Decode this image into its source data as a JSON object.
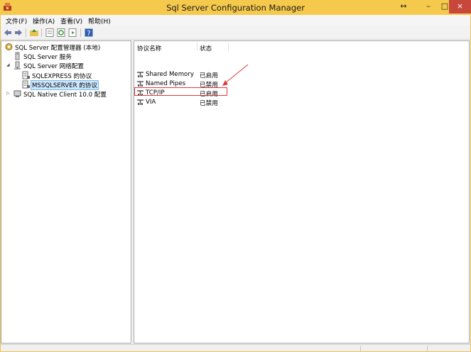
{
  "window": {
    "title": "Sql Server Configuration Manager",
    "restore_symbol": "↔",
    "minimize_symbol": "–",
    "maximize_symbol": "□",
    "close_symbol": "×"
  },
  "menu": {
    "items": [
      "文件(F)",
      "操作(A)",
      "查看(V)",
      "帮助(H)"
    ]
  },
  "toolbar": {
    "icons": [
      "back-icon",
      "forward-icon",
      "up-folder-icon",
      "properties-icon",
      "refresh-icon",
      "export-icon",
      "help-icon"
    ]
  },
  "tree": {
    "root": "SQL Server 配置管理器 (本地)",
    "services": "SQL Server 服务",
    "network_config": "SQL Server 网络配置",
    "sqlexpress_protocols": "SQLEXPRESS 的协议",
    "mssqlserver_protocols": "MSSQLSERVER 的协议",
    "native_client": "SQL Native Client 10.0 配置"
  },
  "list": {
    "columns": {
      "name": "协议名称",
      "status": "状态"
    },
    "rows": [
      {
        "name": "Shared Memory",
        "status": "已启用"
      },
      {
        "name": "Named Pipes",
        "status": "已禁用"
      },
      {
        "name": "TCP/IP",
        "status": "已启用"
      },
      {
        "name": "VIA",
        "status": "已禁用"
      }
    ]
  },
  "colors": {
    "title_bar": "#f5c94c",
    "close_button": "#c7473b",
    "annotation": "#e0393b",
    "selection": "#cce8ff"
  }
}
